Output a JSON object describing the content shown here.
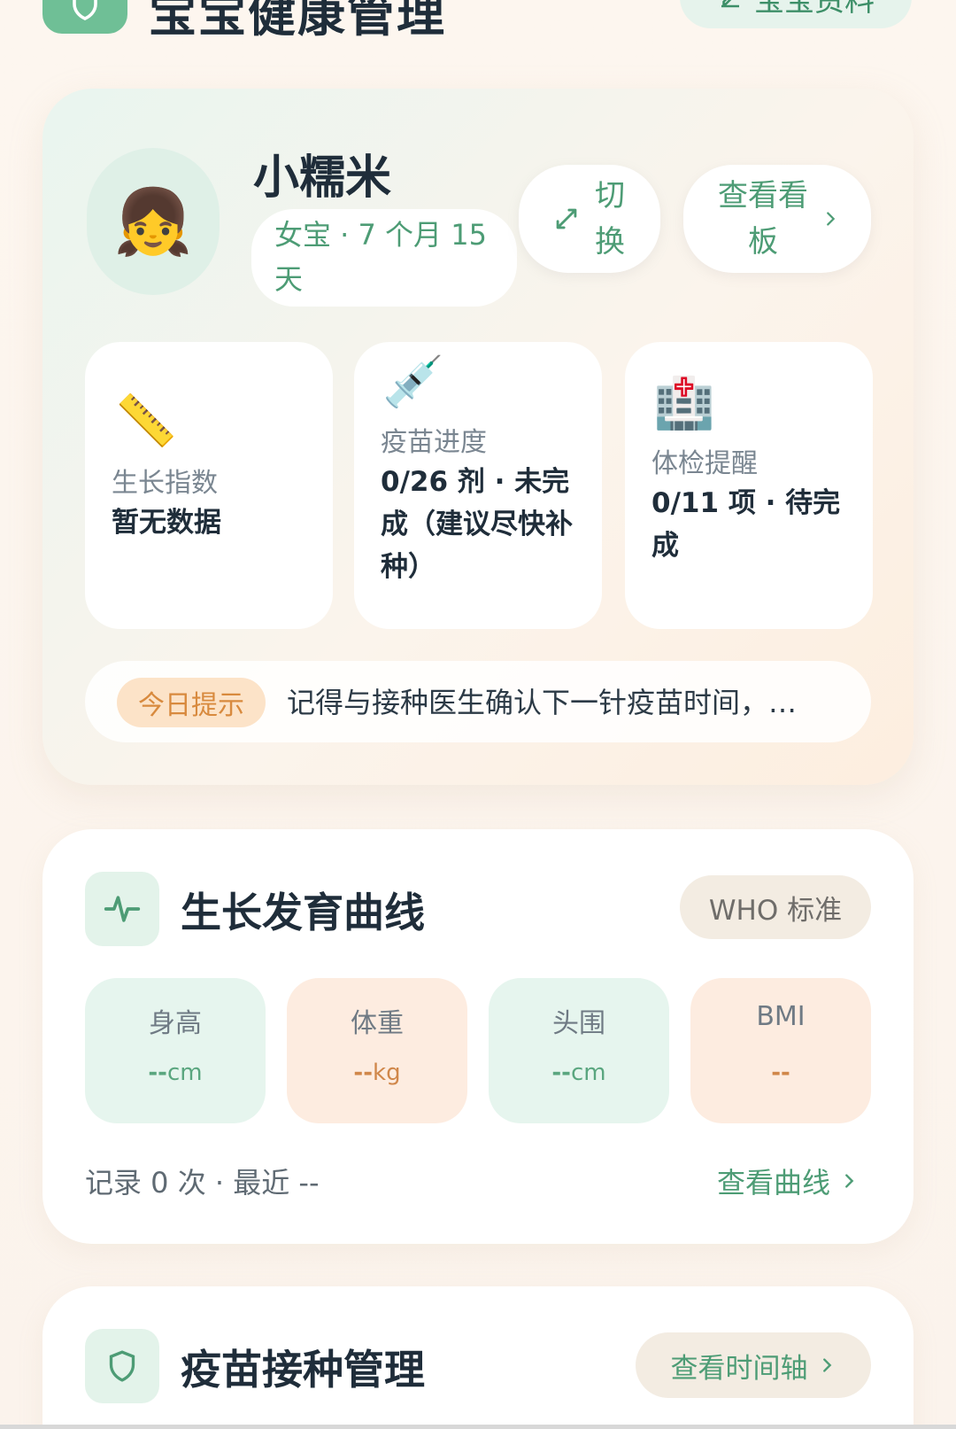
{
  "header": {
    "title": "宝宝健康管理",
    "profile_button": "宝宝资料"
  },
  "baby": {
    "avatar_emoji": "👧",
    "name": "小糯米",
    "meta": "女宝 · 7 个月 15 天",
    "switch_label": "切换",
    "board_label": "查看看板"
  },
  "stats": [
    {
      "icon": "📏",
      "key": "生长指数",
      "value": "暂无数据"
    },
    {
      "icon": "💉",
      "key": "疫苗进度",
      "value": "0/26 剂 · 未完成（建议尽快补种）"
    },
    {
      "icon": "🏥",
      "key": "体检提醒",
      "value": "0/11 项 · 待完成"
    }
  ],
  "tip": {
    "tag": "今日提示",
    "text": "记得与接种医生确认下一针疫苗时间，…"
  },
  "growth": {
    "title": "生长发育曲线",
    "standard": "WHO 标准",
    "metrics": [
      {
        "label": "身高",
        "value": "--",
        "unit": "cm"
      },
      {
        "label": "体重",
        "value": "--",
        "unit": "kg"
      },
      {
        "label": "头围",
        "value": "--",
        "unit": "cm"
      },
      {
        "label": "BMI",
        "value": "--",
        "unit": ""
      }
    ],
    "record_summary": "记录 0 次 · 最近 --",
    "view_curve": "查看曲线"
  },
  "vaccine": {
    "title": "疫苗接种管理",
    "view_timeline": "查看时间轴"
  },
  "colors": {
    "accent_green": "#4d9c75",
    "accent_orange": "#d88a3e"
  }
}
